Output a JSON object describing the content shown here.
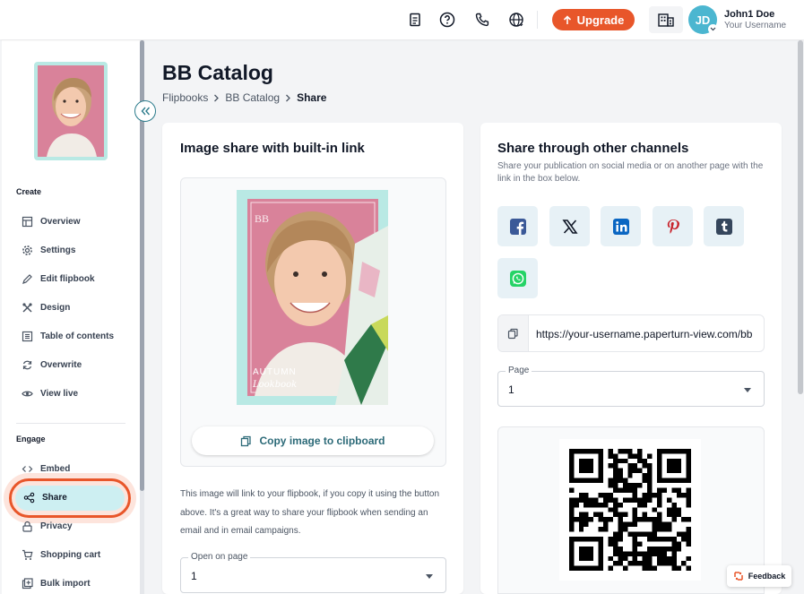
{
  "topbar": {
    "upgrade_label": "Upgrade",
    "avatar_initials": "JD",
    "user_name": "John1 Doe",
    "user_sub": "Your Username"
  },
  "sidebar": {
    "cover_text": "AUTUMN lookbook",
    "sections": {
      "create": "Create",
      "engage": "Engage"
    },
    "create_items": [
      {
        "label": "Overview",
        "icon": "overview-icon"
      },
      {
        "label": "Settings",
        "icon": "gear-icon"
      },
      {
        "label": "Edit flipbook",
        "icon": "pencil-icon"
      },
      {
        "label": "Design",
        "icon": "design-icon"
      },
      {
        "label": "Table of contents",
        "icon": "list-icon"
      },
      {
        "label": "Overwrite",
        "icon": "refresh-icon"
      },
      {
        "label": "View live",
        "icon": "eye-icon"
      }
    ],
    "engage_items": [
      {
        "label": "Embed",
        "icon": "code-icon"
      },
      {
        "label": "Share",
        "icon": "share-icon"
      },
      {
        "label": "Privacy",
        "icon": "lock-icon"
      },
      {
        "label": "Shopping cart",
        "icon": "cart-icon"
      },
      {
        "label": "Bulk import",
        "icon": "import-icon"
      }
    ]
  },
  "main": {
    "title": "BB Catalog",
    "breadcrumb": [
      "Flipbooks",
      "BB Catalog",
      "Share"
    ]
  },
  "image_share": {
    "title": "Image share with built-in link",
    "cover_logo": "BB",
    "cover_line1": "AUTUMN",
    "cover_line2": "Lookbook",
    "copy_button": "Copy image to clipboard",
    "description": "This image will link to your flipbook, if you copy it using the button above. It's a great way to share your flipbook when sending an email and in email campaigns.",
    "open_on_page_label": "Open on page",
    "open_on_page_value": "1"
  },
  "other_channels": {
    "title": "Share through other channels",
    "subtitle": "Share your publication on social media or on another page with the link in the box below.",
    "socials": [
      "facebook-icon",
      "x-icon",
      "linkedin-icon",
      "pinterest-icon",
      "tumblr-icon",
      "whatsapp-icon"
    ],
    "link_url": "https://your-username.paperturn-view.com/bb",
    "page_label": "Page",
    "page_value": "1"
  },
  "feedback_label": "Feedback",
  "colors": {
    "accent": "#e8562a",
    "teal": "#2c7c8c",
    "share_pill": "#cdeff2"
  }
}
